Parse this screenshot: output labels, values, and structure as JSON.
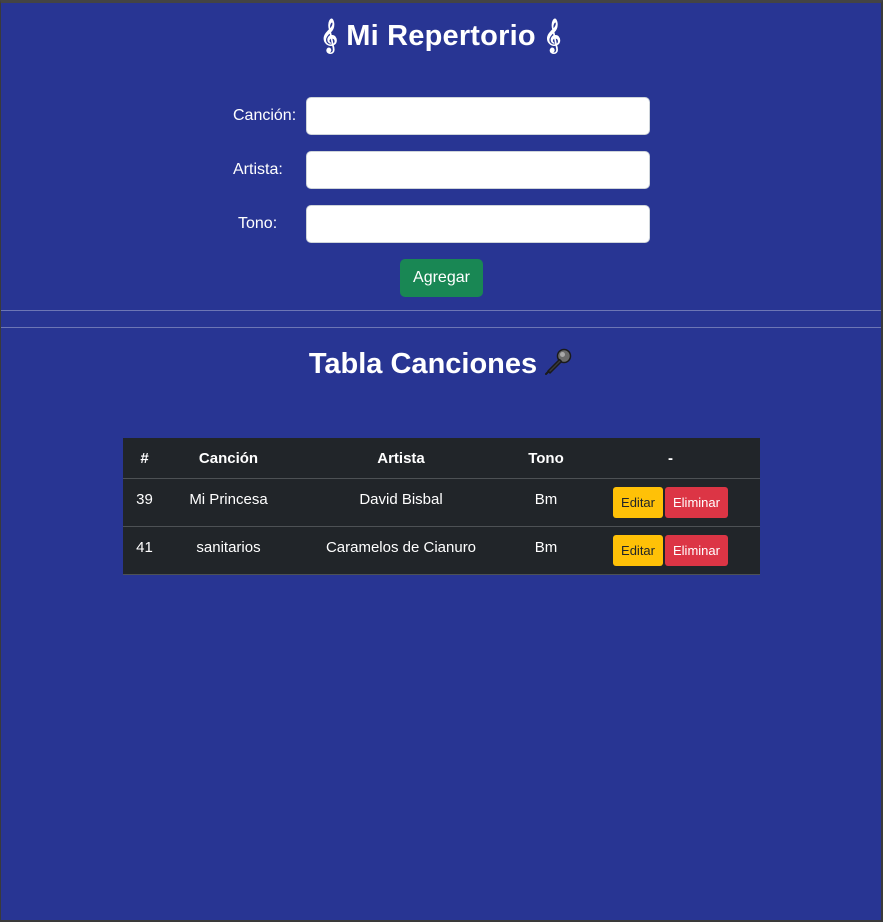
{
  "header": {
    "title": "𝄞 Mi Repertorio 𝄞"
  },
  "form": {
    "song_label": "Canción:",
    "song_value": "",
    "artist_label": "Artista:",
    "artist_value": "",
    "key_label": "Tono:",
    "key_value": "",
    "add_button": "Agregar"
  },
  "table_section": {
    "title": "Tabla Canciones",
    "icon": "microphone-icon",
    "columns": [
      "#",
      "Canción",
      "Artista",
      "Tono",
      "-"
    ],
    "rows": [
      {
        "id": "39",
        "song": "Mi Princesa",
        "artist": "David Bisbal",
        "key": "Bm",
        "edit": "Editar",
        "delete": "Eliminar"
      },
      {
        "id": "41",
        "song": "sanitarios",
        "artist": "Caramelos de Cianuro",
        "key": "Bm",
        "edit": "Editar",
        "delete": "Eliminar"
      }
    ]
  },
  "colors": {
    "background": "#283593",
    "table_bg": "#212529",
    "add_button": "#198754",
    "edit_button": "#ffc107",
    "delete_button": "#dc3545"
  }
}
